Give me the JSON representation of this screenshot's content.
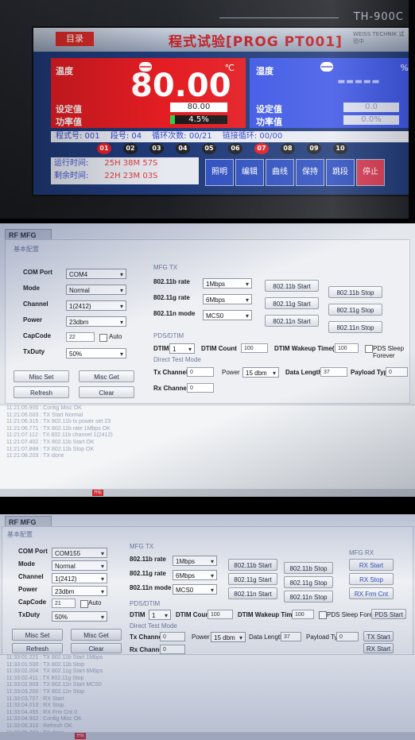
{
  "photo1": {
    "brand": "TH-900C",
    "menu_button": "目录",
    "title": "程式试验[PROG PT001]",
    "subtitle": "WEISS TECHNIK 试验中",
    "temperature": {
      "label": "温度",
      "unit": "℃",
      "value": "80.00",
      "setpoint_label": "设定值",
      "setpoint_value": "80.00",
      "power_label": "功率值",
      "power_value": "4.5%",
      "power_fraction": 0.045
    },
    "humidity": {
      "label": "湿度",
      "unit": "%",
      "value": "-----",
      "setpoint_label": "设定值",
      "setpoint_value": "0.0",
      "power_label": "功率值",
      "power_value": "0.0%"
    },
    "info": {
      "program": "程式号: 001",
      "segment": "段号: 04",
      "cycles": "循环次数: 00/21",
      "link": "链接循环: 00/00"
    },
    "segments": [
      "01",
      "02",
      "03",
      "04",
      "05",
      "06",
      "07",
      "08",
      "09",
      "10"
    ],
    "segments_active": [
      "01",
      "07"
    ],
    "run_time_label": "运行时间:",
    "run_time": "25H 38M 57S",
    "remain_time_label": "剩余时间:",
    "remain_time": "22H 23M 03S",
    "buttons": [
      "照明",
      "编辑",
      "曲线",
      "保持",
      "跳段",
      "停止"
    ]
  },
  "rfmfg": {
    "tab": "RF MFG",
    "basic_config": "基本配置",
    "labels": {
      "com_port": "COM Port",
      "mode": "Mode",
      "channel": "Channel",
      "power": "Power",
      "capcode": "CapCode",
      "txduty": "TxDuty",
      "auto": "Auto"
    },
    "values_top": {
      "com_port": "COM4",
      "mode": "Normal",
      "channel": "1(2412)",
      "power": "23dbm",
      "capcode": "22",
      "txduty": "50%"
    },
    "values_bottom": {
      "com_port": "COM155",
      "mode": "Normal",
      "channel": "1(2412)",
      "power": "23dbm",
      "capcode": "21",
      "txduty": "50%"
    },
    "buttons": {
      "misc_set": "Misc Set",
      "misc_get": "Misc Get",
      "refresh": "Refresh",
      "clear": "Clear"
    },
    "mfg_tx": "MFG TX",
    "rates": {
      "b_label": "802.11b rate",
      "b_value": "1Mbps",
      "g_label": "802.11g rate",
      "g_value": "6Mbps",
      "n_label": "802.11n mode",
      "n_value": "MCS0"
    },
    "tx_buttons": {
      "b_start": "802.11b Start",
      "b_stop": "802.11b Stop",
      "g_start": "802.11g Start",
      "g_stop": "802.11g Stop",
      "n_start": "802.11n Start",
      "n_stop": "802.11n Stop"
    },
    "pds": {
      "title": "PDS/DTIM",
      "dtim_label": "DTIM",
      "dtim_value": "1",
      "dtim_count_label": "DTIM Count",
      "dtim_count_value": "100",
      "wakeup_label": "DTIM Wakeup Time(ms)",
      "wakeup_value": "100",
      "sleep_label": "PDS Sleep Forever",
      "pds_start": "PDS Start"
    },
    "direct": {
      "title": "Direct Test Mode",
      "tx_channel_label": "Tx Channel",
      "tx_channel_value": "0",
      "power_label": "Power",
      "power_value": "15 dbm",
      "data_length_label": "Data Length",
      "data_length_value": "37",
      "payload_label": "Payload Type",
      "payload_value": "0",
      "rx_channel_label": "Rx Channel",
      "rx_channel_value": "0",
      "tx_start": "TX Start",
      "rx_start": "RX Start"
    },
    "mfg_rx": {
      "title": "MFG RX",
      "rx_start": "RX Start",
      "rx_stop": "RX Stop",
      "rx_frm_cnt": "RX Frm Cnt"
    },
    "log_lines": [
      "11:21:05.900 : Config Misc OK",
      "11:21:06.003 : TX Start Normal",
      "11:21:06.315 : TX 802.11b tx power set 23",
      "11:21:06.771 : TX 802.11b rate 1Mbps OK",
      "11:21:07.112 : TX 802.11b channel 1(2412)",
      "11:21:07.402 : TX 802.11b Start OK",
      "11:21:07.888 : TX 802.11b Stop OK",
      "11:21:08.203 : TX done"
    ],
    "log_lines_bottom": [
      "11:33:01.221 : TX 802.11b Start 1Mbps",
      "11:33:01.500 : TX 802.11b Stop",
      "11:33:02.004 : TX 802.11g Start 6Mbps",
      "11:33:02.411 : TX 802.11g Stop",
      "11:33:02.903 : TX 802.11n Start MCS0",
      "11:33:03.200 : TX 802.11n Stop",
      "11:33:03.707 : RX Start",
      "11:33:04.010 : RX Stop",
      "11:33:04.455 : RX Frm Cnt 0",
      "11:33:04.902 : Config Misc OK",
      "11:33:05.310 : Refresh OK",
      "11:33:05.702 : TX done"
    ],
    "taskbar_tag": "开始"
  }
}
